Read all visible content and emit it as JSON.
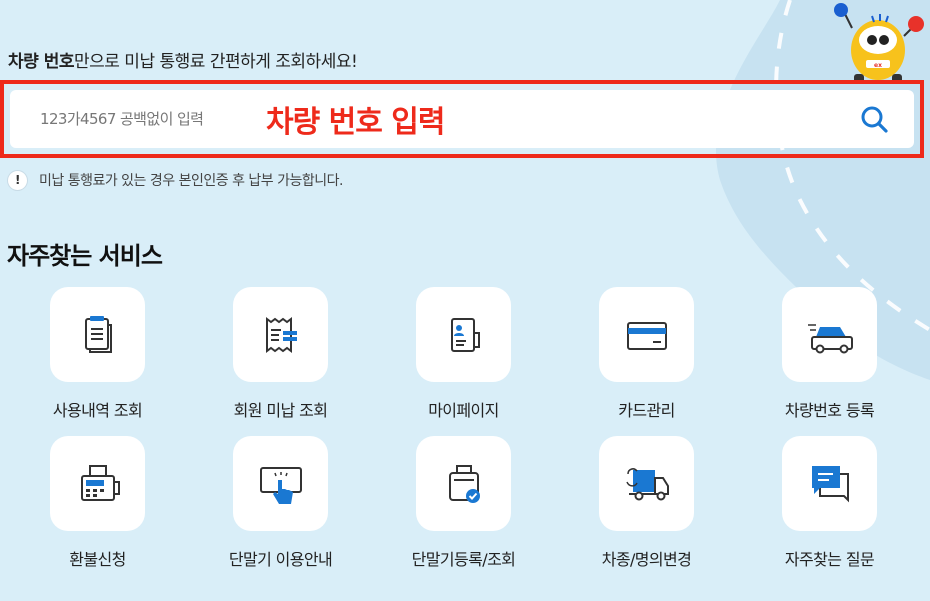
{
  "header": {
    "headline_bold": "차량 번호",
    "headline_rest": "만으로 미납 통행료 간편하게 조회하세요!"
  },
  "search": {
    "placeholder": "123가4567 공백없이 입력",
    "annotation": "차량 번호 입력",
    "button_icon": "search-icon"
  },
  "notice": {
    "icon": "exclamation-icon",
    "text": "미납 통행료가 있는 경우 본인인증 후 납부 가능합니다."
  },
  "services": {
    "title": "자주찾는 서비스",
    "items": [
      {
        "label": "사용내역 조회",
        "icon": "usage-history-icon"
      },
      {
        "label": "회원 미납 조회",
        "icon": "unpaid-receipt-icon"
      },
      {
        "label": "마이페이지",
        "icon": "mypage-profile-icon"
      },
      {
        "label": "카드관리",
        "icon": "credit-card-icon"
      },
      {
        "label": "차량번호 등록",
        "icon": "vehicle-register-icon"
      },
      {
        "label": "환불신청",
        "icon": "refund-machine-icon"
      },
      {
        "label": "단말기 이용안내",
        "icon": "terminal-guide-icon"
      },
      {
        "label": "단말기등록/조회",
        "icon": "terminal-register-icon"
      },
      {
        "label": "차종/명의변경",
        "icon": "truck-change-icon"
      },
      {
        "label": "자주찾는 질문",
        "icon": "faq-chat-icon"
      }
    ]
  },
  "colors": {
    "background": "#d9eef8",
    "accent_blue": "#1a78d2",
    "highlight_red": "#ee2a1b"
  }
}
